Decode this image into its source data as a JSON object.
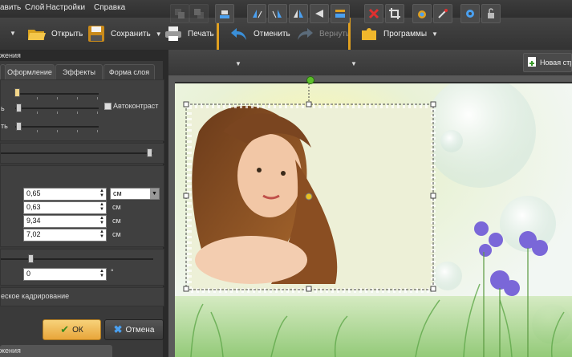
{
  "menu": [
    "авить",
    "Слой",
    "Настройки",
    "Справка"
  ],
  "toolbar": {
    "open_label": "Открыть",
    "save_label": "Сохранить",
    "print_label": "Печать",
    "undo_label": "Отменить",
    "redo_label": "Вернуть",
    "programs_label": "Программы"
  },
  "panel": {
    "title": "жения",
    "tabs": [
      "Оформление",
      "Эффекты",
      "Форма слоя"
    ],
    "slider1_label": "ь",
    "slider2_label": "ть",
    "autocontrast_label": "Автоконтраст",
    "size_values": [
      "0,65",
      "0,63",
      "9,34",
      "7,02"
    ],
    "unit": "см",
    "rotation_value": "0",
    "degree": "°",
    "autocrop_label": "еское кадрирование",
    "ok_label": "ОК",
    "cancel_label": "Отмена",
    "bottom_tab_label": "жения"
  },
  "toolbar2": {
    "new_page_label": "Новая стр"
  },
  "colors": {
    "accent_orange": "#e0a020",
    "ok_button": "#f0bd58",
    "panel_bg": "#3a3a3a"
  },
  "icons": [
    "folder-open-icon",
    "floppy-save-icon",
    "printer-icon",
    "undo-arrow-icon",
    "redo-arrow-icon",
    "puzzle-programs-icon",
    "align-icon",
    "flip-icon",
    "crop-icon",
    "delete-icon",
    "settings-icon",
    "lock-icon",
    "new-page-icon",
    "checkmark-icon",
    "cross-icon"
  ]
}
